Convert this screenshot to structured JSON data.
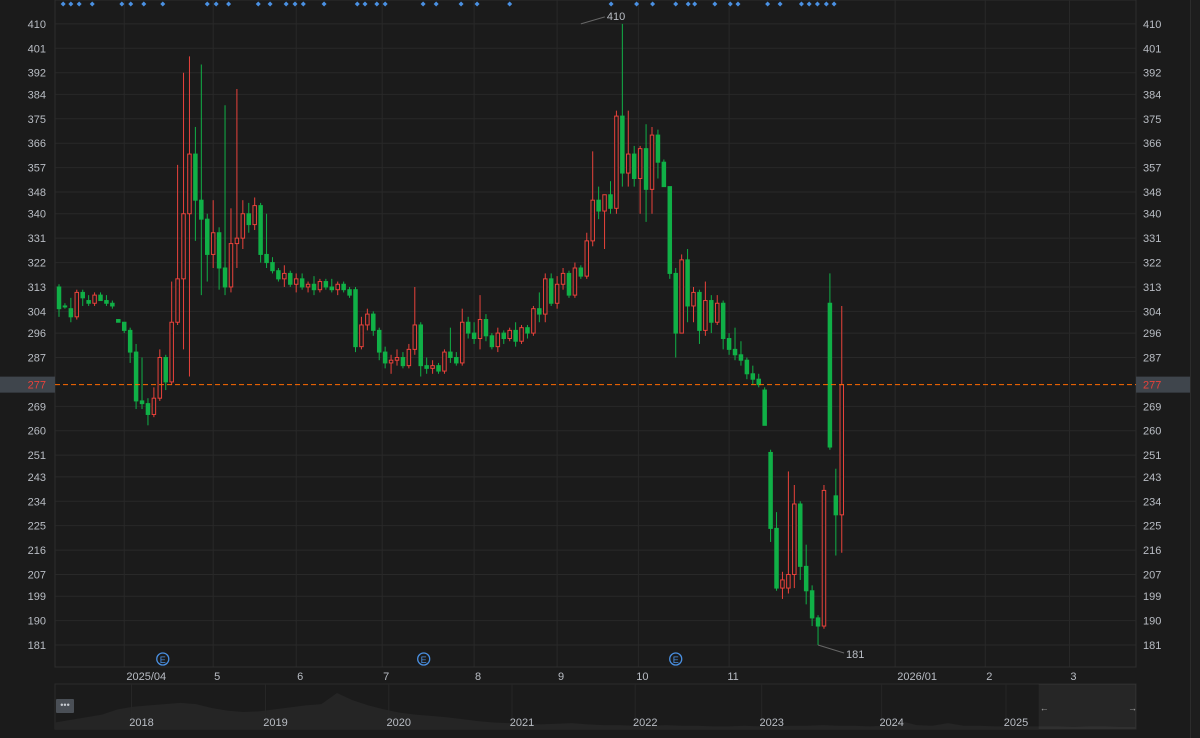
{
  "chart_data": {
    "type": "candlestick",
    "title": "",
    "up_color": "#e8423b",
    "down_color": "#10b047",
    "ylim": [
      172.9,
      418.8
    ],
    "y_ticks": [
      "410",
      "401",
      "392",
      "384",
      "375",
      "366",
      "357",
      "348",
      "340",
      "331",
      "322",
      "313",
      "304",
      "296",
      "287",
      "269",
      "260",
      "251",
      "243",
      "234",
      "225",
      "216",
      "207",
      "199",
      "190",
      "181"
    ],
    "current_price": 277,
    "current_price_label": "277",
    "current_price_color": "#ff6a00",
    "max_label": "410",
    "max_index": 88,
    "min_label": "181",
    "min_index": 128,
    "x_ticks": [
      {
        "label": "2025/04",
        "index": 11
      },
      {
        "label": "5",
        "index": 26
      },
      {
        "label": "6",
        "index": 40
      },
      {
        "label": "7",
        "index": 54.5
      },
      {
        "label": "8",
        "index": 70
      },
      {
        "label": "9",
        "index": 84
      },
      {
        "label": "10",
        "index": 97.7
      },
      {
        "label": "11",
        "index": 113
      },
      {
        "label": "2026/01",
        "index": 141
      },
      {
        "label": "2",
        "index": 156.2
      },
      {
        "label": "3",
        "index": 170.4
      }
    ],
    "earnings_markers": {
      "label": "E",
      "indices": [
        17.5,
        61.5,
        104
      ]
    },
    "event_marker_indices": [
      0.7,
      2,
      3.4,
      5.6,
      10.6,
      12.1,
      14.3,
      17.5,
      25,
      26.5,
      28.6,
      33.6,
      35.6,
      38.3,
      39.8,
      41.2,
      44.7,
      50.3,
      51.6,
      53.6,
      55,
      61.4,
      63.6,
      67.8,
      70.5,
      76,
      93.1,
      97.4,
      100.1,
      104,
      106.1,
      107.2,
      110.6,
      113.2,
      114.5,
      119.5,
      121.6,
      125.2,
      126.5,
      127.9,
      129.4,
      130.7
    ],
    "candles": [
      [
        313,
        314,
        302,
        305
      ],
      [
        306,
        307,
        305,
        306
      ],
      [
        305,
        309,
        300,
        302
      ],
      [
        302,
        312,
        301,
        311
      ],
      [
        311,
        312,
        306,
        309
      ],
      [
        308,
        310,
        306,
        307
      ],
      [
        307,
        311,
        306,
        310
      ],
      [
        310,
        311,
        308,
        308
      ],
      [
        308,
        310,
        306,
        307
      ],
      [
        307,
        308,
        305,
        306
      ],
      [
        301,
        301,
        300,
        300
      ],
      [
        300,
        300,
        296,
        297
      ],
      [
        297,
        298,
        285,
        289
      ],
      [
        289,
        292,
        268,
        271
      ],
      [
        271,
        287,
        268,
        270
      ],
      [
        270,
        272,
        262,
        266
      ],
      [
        266,
        276,
        265,
        272
      ],
      [
        272,
        290,
        271,
        287
      ],
      [
        287,
        288,
        275,
        278
      ],
      [
        278,
        315,
        277,
        300
      ],
      [
        300,
        358,
        299,
        316
      ],
      [
        316,
        392,
        290,
        340
      ],
      [
        340,
        398,
        280,
        362
      ],
      [
        362,
        372,
        330,
        345
      ],
      [
        345,
        395,
        310,
        338
      ],
      [
        338,
        340,
        315,
        325
      ],
      [
        325,
        345,
        320,
        333
      ],
      [
        333,
        335,
        312,
        320
      ],
      [
        320,
        380,
        310,
        313
      ],
      [
        313,
        342,
        311,
        329
      ],
      [
        329,
        386,
        320,
        331
      ],
      [
        331,
        345,
        327,
        340
      ],
      [
        340,
        344,
        333,
        336
      ],
      [
        336,
        346,
        334,
        343
      ],
      [
        343,
        344,
        322,
        325
      ],
      [
        325,
        340,
        320,
        322
      ],
      [
        322,
        324,
        318,
        319
      ],
      [
        319,
        320,
        315,
        316
      ],
      [
        316,
        321,
        313,
        318
      ],
      [
        318,
        319,
        313,
        314
      ],
      [
        314,
        318,
        311,
        316
      ],
      [
        316,
        318,
        312,
        313
      ],
      [
        313,
        315,
        311,
        314
      ],
      [
        314,
        317,
        310,
        312
      ],
      [
        312,
        316,
        311,
        315
      ],
      [
        315,
        316,
        312,
        313
      ],
      [
        313,
        316,
        311,
        312
      ],
      [
        312,
        315,
        310,
        314
      ],
      [
        314,
        315,
        311,
        312
      ],
      [
        312,
        313,
        309,
        310
      ],
      [
        312,
        313,
        289,
        291
      ],
      [
        291,
        302,
        290,
        299
      ],
      [
        299,
        305,
        297,
        303
      ],
      [
        303,
        304,
        295,
        297
      ],
      [
        297,
        298,
        286,
        289
      ],
      [
        289,
        291,
        283,
        285
      ],
      [
        285,
        288,
        281,
        286
      ],
      [
        286,
        290,
        284,
        287
      ],
      [
        287,
        289,
        283,
        284
      ],
      [
        284,
        292,
        283,
        290
      ],
      [
        290,
        313,
        288,
        299
      ],
      [
        299,
        300,
        280,
        284
      ],
      [
        284,
        287,
        281,
        283
      ],
      [
        283,
        286,
        281,
        284
      ],
      [
        284,
        285,
        281,
        282
      ],
      [
        282,
        290,
        281,
        289
      ],
      [
        289,
        298,
        285,
        287
      ],
      [
        287,
        289,
        284,
        285
      ],
      [
        285,
        305,
        284,
        300
      ],
      [
        300,
        302,
        294,
        296
      ],
      [
        296,
        300,
        292,
        294
      ],
      [
        294,
        310,
        290,
        301
      ],
      [
        301,
        303,
        293,
        295
      ],
      [
        295,
        296,
        290,
        291
      ],
      [
        291,
        298,
        289,
        296
      ],
      [
        296,
        297,
        292,
        294
      ],
      [
        294,
        298,
        293,
        297
      ],
      [
        297,
        300,
        291,
        293
      ],
      [
        293,
        299,
        292,
        298
      ],
      [
        298,
        299,
        294,
        296
      ],
      [
        296,
        306,
        295,
        305
      ],
      [
        305,
        311,
        300,
        303
      ],
      [
        303,
        318,
        300,
        316
      ],
      [
        316,
        318,
        306,
        307
      ],
      [
        307,
        317,
        305,
        314
      ],
      [
        314,
        320,
        312,
        318
      ],
      [
        318,
        319,
        309,
        310
      ],
      [
        310,
        322,
        309,
        320
      ],
      [
        320,
        321,
        316,
        317
      ],
      [
        317,
        333,
        316,
        330
      ],
      [
        330,
        363,
        328,
        345
      ],
      [
        345,
        350,
        338,
        341
      ],
      [
        341,
        347,
        327,
        347
      ],
      [
        347,
        352,
        340,
        342
      ],
      [
        342,
        378,
        340,
        376
      ],
      [
        376,
        410,
        350,
        355
      ],
      [
        355,
        378,
        350,
        362
      ],
      [
        362,
        365,
        350,
        353
      ],
      [
        353,
        365,
        340,
        364
      ],
      [
        364,
        373,
        337,
        349
      ],
      [
        349,
        372,
        340,
        369
      ],
      [
        369,
        371,
        353,
        359
      ],
      [
        359,
        360,
        350,
        350
      ],
      [
        350,
        350,
        316,
        318
      ],
      [
        318,
        320,
        287,
        296
      ],
      [
        296,
        325,
        296,
        323
      ],
      [
        323,
        327,
        300,
        306
      ],
      [
        306,
        313,
        300,
        311
      ],
      [
        311,
        312,
        292,
        297
      ],
      [
        297,
        315,
        295,
        308
      ],
      [
        308,
        310,
        296,
        300
      ],
      [
        300,
        310,
        299,
        307
      ],
      [
        307,
        308,
        290,
        294
      ],
      [
        294,
        296,
        288,
        290
      ],
      [
        290,
        298,
        286,
        288
      ],
      [
        288,
        293,
        284,
        286
      ],
      [
        286,
        287,
        279,
        281
      ],
      [
        281,
        284,
        277,
        279
      ],
      [
        279,
        281,
        276,
        277
      ],
      [
        275,
        276,
        262,
        262
      ],
      [
        252,
        253,
        219,
        224
      ],
      [
        224,
        230,
        201,
        202
      ],
      [
        202,
        208,
        198,
        205
      ],
      [
        202,
        245,
        200,
        207
      ],
      [
        207,
        240,
        202,
        233
      ],
      [
        233,
        234,
        205,
        210
      ],
      [
        210,
        218,
        196,
        201
      ],
      [
        201,
        203,
        188,
        191
      ],
      [
        191,
        192,
        181,
        188
      ],
      [
        188,
        240,
        187,
        238
      ],
      [
        307,
        318,
        253,
        254
      ],
      [
        236,
        246,
        214,
        229
      ],
      [
        229,
        306,
        215,
        277
      ]
    ],
    "navigator": {
      "years": [
        {
          "label": "2018",
          "pos": 0.08
        },
        {
          "label": "2019",
          "pos": 0.204
        },
        {
          "label": "2020",
          "pos": 0.318
        },
        {
          "label": "2021",
          "pos": 0.432
        },
        {
          "label": "2022",
          "pos": 0.546
        },
        {
          "label": "2023",
          "pos": 0.663
        },
        {
          "label": "2024",
          "pos": 0.774
        },
        {
          "label": "2025",
          "pos": 0.889
        }
      ],
      "history": [
        10,
        14,
        18,
        22,
        30,
        34,
        36,
        38,
        40,
        38,
        32,
        28,
        26,
        27,
        30,
        33,
        36,
        38,
        55,
        44,
        36,
        30,
        25,
        22,
        20,
        18,
        15,
        12,
        10,
        9,
        8,
        7,
        8,
        9,
        7,
        6,
        6,
        5,
        5,
        6,
        5,
        5,
        4,
        4,
        5,
        4,
        4,
        5,
        5,
        6,
        5,
        5,
        4,
        5,
        12,
        6,
        5,
        9,
        5,
        5,
        4,
        4,
        4,
        4,
        4,
        3,
        4,
        4,
        3,
        3
      ],
      "window_start": 0.91,
      "window_end": 1.0,
      "left_arrow": "←",
      "right_arrow": "→",
      "menu_label": "•••"
    }
  }
}
